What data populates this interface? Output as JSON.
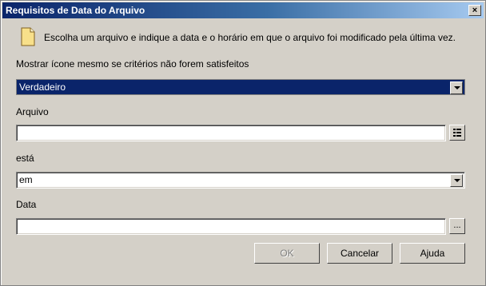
{
  "window": {
    "title": "Requisitos de Data do Arquivo",
    "close_label": "×"
  },
  "description": "Escolha um arquivo e indique a data e o horário em que o arquivo foi modificado pela última vez.",
  "show_icon": {
    "label": "Mostrar ícone mesmo se critérios não forem satisfeitos",
    "value": "Verdadeiro"
  },
  "file": {
    "label": "Arquivo",
    "value": "",
    "browse_icon": "browse-list-icon"
  },
  "operator": {
    "label": "está",
    "value": "em"
  },
  "date": {
    "label": "Data",
    "value": "",
    "browse_label": "..."
  },
  "buttons": {
    "ok": "OK",
    "cancel": "Cancelar",
    "help": "Ajuda"
  }
}
